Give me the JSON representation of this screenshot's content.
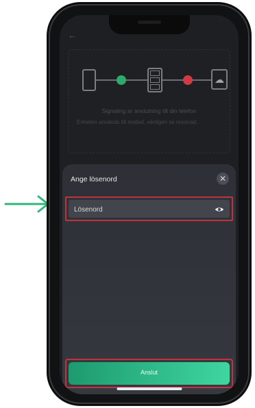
{
  "background": {
    "status_text": "Signaling ar anslutning till din telefon",
    "description": "Enheten används till mobiel, vänligen se resonad."
  },
  "sheet": {
    "title": "Ange lösenord",
    "password_placeholder": "Lösenord",
    "submit_label": "Anslut"
  },
  "colors": {
    "accent_start": "#1e9a6f",
    "accent_end": "#3fd6a0",
    "highlight_border": "#c4323d",
    "arrow": "#2db87a",
    "status_ok": "#2cab6b",
    "status_error": "#d23a43"
  },
  "icons": {
    "back": "back-arrow-icon",
    "close": "close-icon",
    "visibility": "eye-icon",
    "pointer": "pointer-arrow-icon"
  }
}
